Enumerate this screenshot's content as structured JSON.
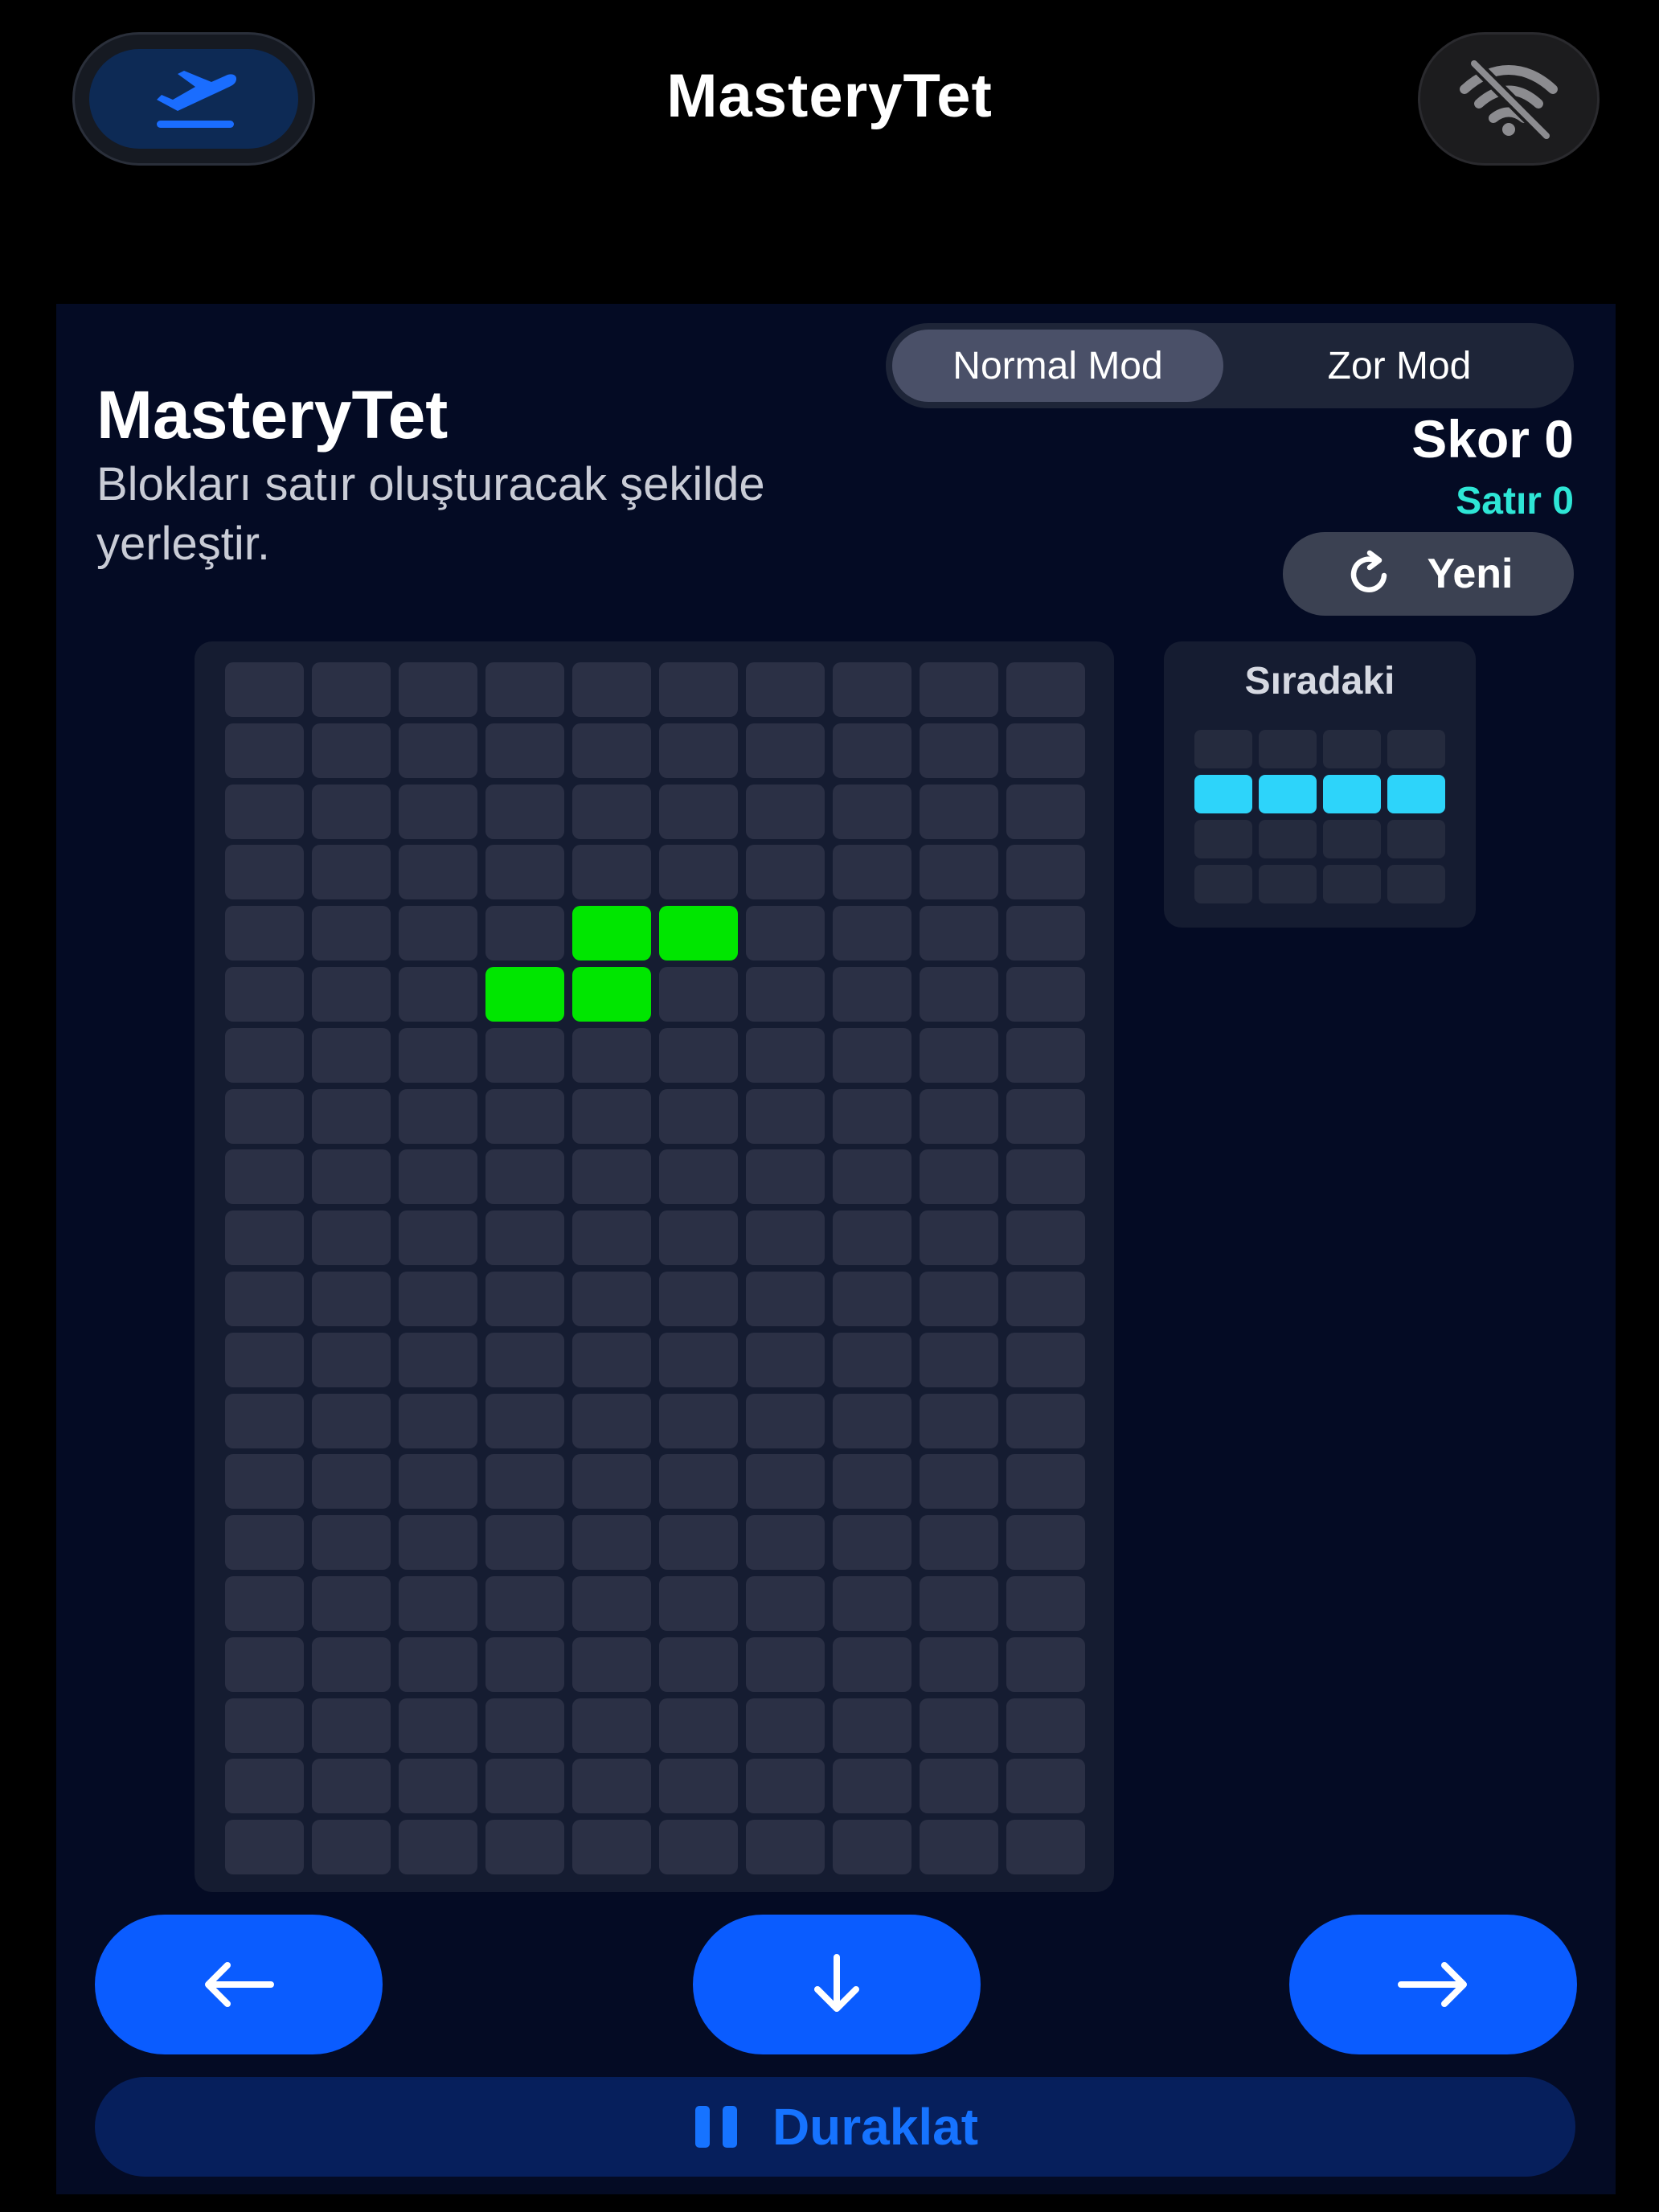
{
  "header": {
    "title": "MasteryTet",
    "left_icon": "airplane-takeoff-icon",
    "right_icon": "wifi-off-icon"
  },
  "game": {
    "title": "MasteryTet",
    "subtitle": "Blokları satır oluşturacak şekilde yerleştir.",
    "modes": [
      "Normal Mod",
      "Zor Mod"
    ],
    "active_mode": "Normal Mod",
    "score_text": "Skor 0",
    "score": 0,
    "lines_text": "Satır 0",
    "lines": 0,
    "new_label": "Yeni",
    "next_label": "Sıradaki",
    "pause_label": "Duraklat"
  },
  "board": {
    "columns": 10,
    "rows": 20,
    "piece_color": "#00e600",
    "empty_color": "#2b3045",
    "filled_cells": [
      [
        4,
        4
      ],
      [
        4,
        5
      ],
      [
        5,
        3
      ],
      [
        5,
        4
      ]
    ]
  },
  "next_piece": {
    "columns": 4,
    "rows": 4,
    "color": "#2dd4fa",
    "filled_cells": [
      [
        1,
        0
      ],
      [
        1,
        1
      ],
      [
        1,
        2
      ],
      [
        1,
        3
      ]
    ]
  },
  "controls": {
    "left_icon": "arrow-left-icon",
    "down_icon": "arrow-down-icon",
    "right_icon": "arrow-right-icon",
    "pause_icon": "pause-icon"
  },
  "colors": {
    "accent": "#0a5cff",
    "lines_accent": "#2ee6d6",
    "panel_bg": "#040b24"
  }
}
